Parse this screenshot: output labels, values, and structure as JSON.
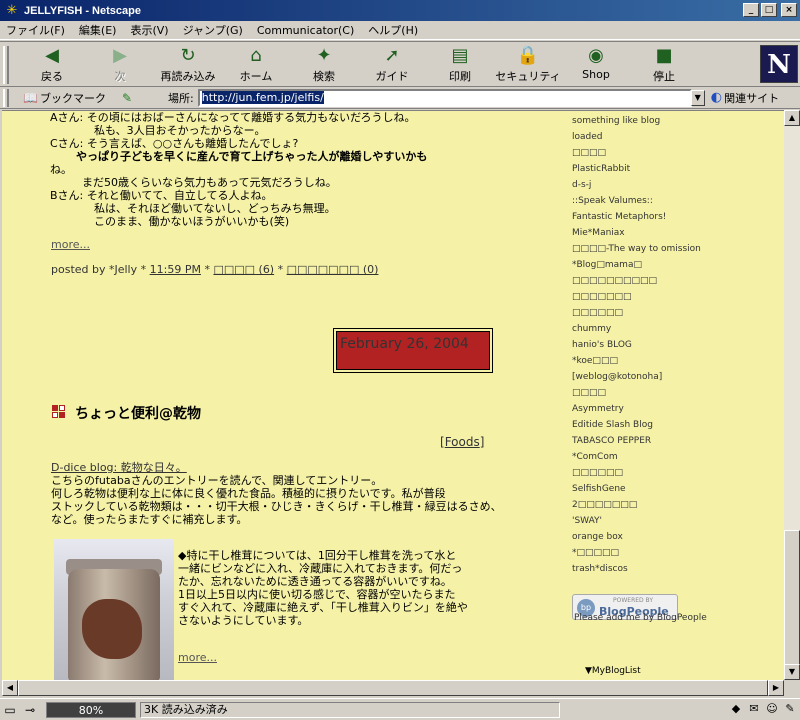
{
  "window": {
    "title": "JELLYFISH - Netscape",
    "buttons": {
      "minimize": "_",
      "maximize": "□",
      "close": "×"
    }
  },
  "menu": [
    "ファイル(F)",
    "編集(E)",
    "表示(V)",
    "ジャンプ(G)",
    "Communicator(C)",
    "ヘルプ(H)"
  ],
  "toolbar": [
    {
      "label": "戻る",
      "icon": "back-arrow-icon",
      "glyph": "◀",
      "disabled": false
    },
    {
      "label": "次",
      "icon": "forward-arrow-icon",
      "glyph": "▶",
      "disabled": true
    },
    {
      "label": "再読み込み",
      "icon": "reload-icon",
      "glyph": "↻",
      "disabled": false
    },
    {
      "label": "ホーム",
      "icon": "home-icon",
      "glyph": "⌂",
      "disabled": false
    },
    {
      "label": "検索",
      "icon": "search-icon",
      "glyph": "✦",
      "disabled": false
    },
    {
      "label": "ガイド",
      "icon": "guide-icon",
      "glyph": "➚",
      "disabled": false
    },
    {
      "label": "印刷",
      "icon": "print-icon",
      "glyph": "▤",
      "disabled": false
    },
    {
      "label": "セキュリティ",
      "icon": "security-lock-icon",
      "glyph": "🔒",
      "disabled": false
    },
    {
      "label": "Shop",
      "icon": "shop-icon",
      "glyph": "◉",
      "disabled": false
    },
    {
      "label": "停止",
      "icon": "stop-icon",
      "glyph": "■",
      "disabled": false
    }
  ],
  "logo": "N",
  "location": {
    "bookmarks_label": "ブックマーク",
    "location_label": "場所:",
    "url": "http://jun.fem.jp/jelfis/",
    "related_label": "関連サイト"
  },
  "post1": {
    "lines": [
      {
        "text": "Aさん: その頃にはおばーさんになってて離婚する気力もないだろうしね。",
        "cls": ""
      },
      {
        "text": "私も、3人目おそかったからなー。",
        "cls": "ind1"
      },
      {
        "text": "Cさん: そう言えば、○○さんも離婚したんでしょ?",
        "cls": ""
      },
      {
        "text": "やっぱり子どもを早くに産んで育て上げちゃった人が離婚しやすいかも",
        "cls": "ind2 bold"
      },
      {
        "text": "ね。",
        "cls": ""
      },
      {
        "text": "まだ50歳くらいなら気力もあって元気だろうしね。",
        "cls": "ind3"
      },
      {
        "text": "Bさん: それと働いてて、自立してる人よね。",
        "cls": ""
      },
      {
        "text": "私は、それほど働いてないし、どっちみち無理。",
        "cls": "ind1"
      },
      {
        "text": "このまま、働かないほうがいいかも(笑)",
        "cls": "ind1"
      }
    ],
    "more": "more...",
    "posted_by": "posted by *Jelly * ",
    "time": "11:59 PM",
    "sep": " * ",
    "comments": "□□□□ (6)",
    "trackbacks": "□□□□□□□ (0)"
  },
  "date_header": "February 26, 2004",
  "post2": {
    "title": "ちょっと便利@乾物",
    "category_open": "[",
    "category": "Foods",
    "category_close": "]",
    "lines": [
      {
        "text": "D-dice blog: 乾物な日々。",
        "link": true
      },
      {
        "text": "こちらのfutabaさんのエントリーを読んで、関連してエントリー。",
        "link": false
      },
      {
        "text": " ",
        "link": false
      },
      {
        "text": "何しろ乾物は便利な上に体に良く優れた食品。積極的に摂りたいです。私が普段",
        "link": false
      },
      {
        "text": "ストックしている乾物類は・・・切干大根・ひじき・きくらげ・干し椎茸・緑豆はるさめ、",
        "link": false
      },
      {
        "text": "など。使ったらまたすぐに補充します。",
        "link": false
      }
    ],
    "side_lines": [
      "◆特に干し椎茸については、1回分干し椎茸を洗って水と",
      "一緒にビンなどに入れ、冷蔵庫に入れておきます。何だっ",
      "たか、忘れないために透き通ってる容器がいいですね。",
      "1日以上5日以内に使い切る感じで、容器が空いたらまた",
      "すぐ入れて、冷蔵庫に絶えず、「干し椎茸入りビン」を絶や",
      "さないようにしています。"
    ],
    "more": "more..."
  },
  "sidebar": [
    "something like blog",
    "loaded",
    "□□□□",
    "PlasticRabbit",
    "d-s-j",
    "::Speak Valumes::",
    "Fantastic Metaphors!",
    "Mie*Maniax",
    "□□□□-The way to omission",
    "*Blog□mama□",
    "□□□□□□□□□□",
    "□□□□□□□",
    "□□□□□□",
    "chummy",
    "hanio's BLOG",
    "*koe□□□",
    "[weblog@kotonoha]",
    "□□□□",
    "Asymmetry",
    "Editide Slash Blog",
    "TABASCO PEPPER",
    "*ComCom",
    "□□□□□□",
    "SelfishGene",
    "2□□□□□□□",
    "'SWAY'",
    "orange box",
    "*□□□□□",
    "trash*discos"
  ],
  "blogpeople": {
    "powered": "POWERED BY",
    "name": "BlogPeople",
    "logo": "bp",
    "caption": "Please add me by BlogPeople"
  },
  "myblog": "▼MyBlogList",
  "status": {
    "progress_value": 80,
    "progress": "80%",
    "text": "3K 読み込み済み"
  },
  "colors": {
    "page_bg": "#f5f2a8",
    "date_box": "#b22222",
    "titlebar": "#0a246a"
  }
}
